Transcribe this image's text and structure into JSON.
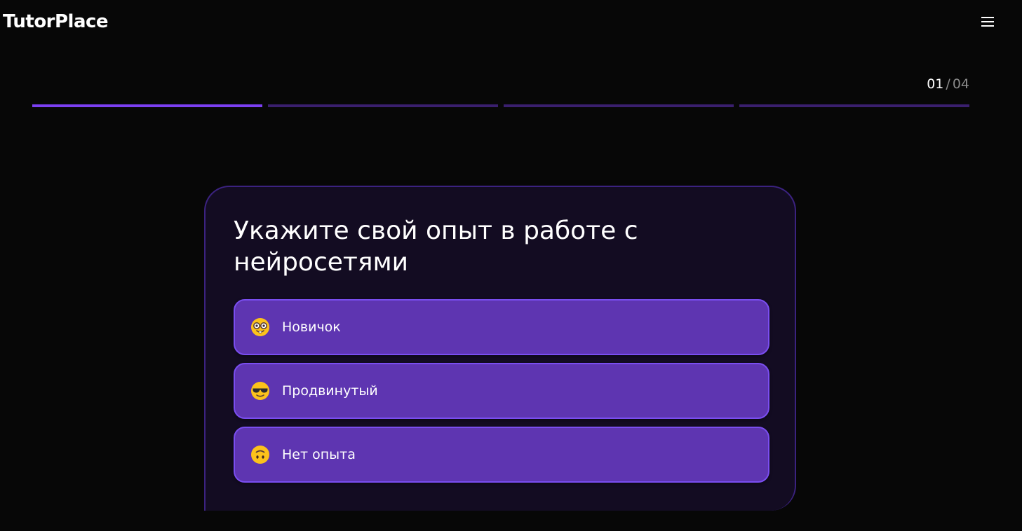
{
  "header": {
    "logo_text": "TutorPlace",
    "menu_icon": "hamburger-menu-icon"
  },
  "progress": {
    "current": "01",
    "separator": "/",
    "total": "04",
    "steps_total": 4,
    "steps_completed": 1,
    "active_color": "#7b3ff2",
    "inactive_color": "#3a1f6e"
  },
  "quiz": {
    "question": "Укажите свой опыт в работе с нейросетями",
    "options": [
      {
        "label": "Новичок",
        "icon": "nerd-face-emoji-icon"
      },
      {
        "label": "Продвинутый",
        "icon": "sunglasses-face-emoji-icon"
      },
      {
        "label": "Нет опыта",
        "icon": "upside-down-face-emoji-icon"
      }
    ]
  },
  "colors": {
    "background": "#070707",
    "card_background": "#130c22",
    "card_border": "#3b2280",
    "option_background": "#5e35b1",
    "option_border": "#7a4ef0"
  }
}
